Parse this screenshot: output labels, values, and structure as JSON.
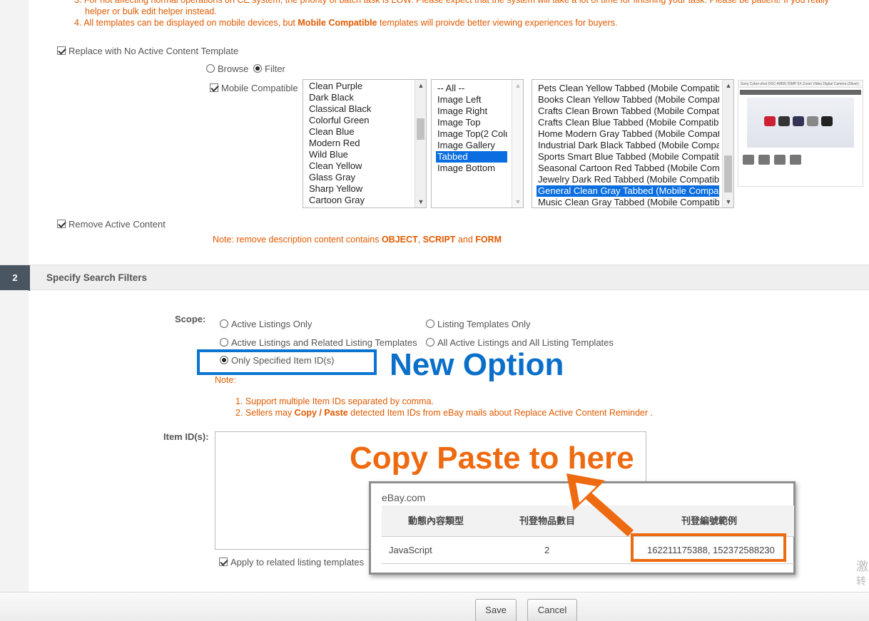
{
  "notes_top": {
    "line3a": "3. For not affecting normal operations on CE system, the priority of batch task is LOW. Please expect that the system will take a lot of time for finishing your task. Please be patient! If you really",
    "line3b": "helper or bulk edit helper instead.",
    "line4_prefix": "4. All templates can be displayed on mobile devices, but ",
    "line4_bold": "Mobile Compatible",
    "line4_suffix": " templates will proivde better viewing experiences for buyers."
  },
  "replace_template": {
    "checkbox_label": "Replace with No Active Content Template",
    "checked": true,
    "radio_browse": "Browse",
    "radio_filter": "Filter",
    "selected_radio": "Filter",
    "mobile_compatible_label": "Mobile Compatible",
    "mobile_compatible_checked": true,
    "styles": [
      "Clean Purple",
      "Dark Black",
      "Classical Black",
      "Colorful Green",
      "Clean Blue",
      "Modern Red",
      "Wild Blue",
      "Clean Yellow",
      "Glass Gray",
      "Sharp Yellow",
      "Cartoon Gray"
    ],
    "layouts": [
      "-- All --",
      "Image Left",
      "Image Right",
      "Image Top",
      "Image Top(2 Colun",
      "Image Gallery",
      "Tabbed",
      "Image Bottom"
    ],
    "layout_selected": "Tabbed",
    "templates": [
      "Pets Clean Yellow Tabbed (Mobile Compatib",
      "Books Clean Yellow Tabbed (Mobile Compat",
      "Crafts Clean Brown Tabbed (Mobile Compatil",
      "Crafts Clean Blue Tabbed (Mobile Compatible",
      "Home Modern Gray Tabbed (Mobile Compati",
      "Industrial Dark Black Tabbed (Mobile Compa",
      "Sports Smart Blue Tabbed (Mobile Compatib",
      "Seasonal Cartoon Red Tabbed (Mobile Comp",
      "Jewelry Dark Red Tabbed (Mobile Compatib",
      "General Clean Gray Tabbed (Mobile Compa",
      "Music Clean Gray Tabbed (Mobile Compatibl"
    ],
    "template_selected": "General Clean Gray Tabbed (Mobile Compa",
    "preview_title": "Sony Cyber-shot DSC-W800 20MP 5X Zoom Video Digital Camera (Silver)"
  },
  "remove_active": {
    "checkbox_label": "Remove Active Content",
    "checked": true,
    "note_prefix": "Note: remove description content contains ",
    "note_object": "OBJECT",
    "note_sep1": ", ",
    "note_script": "SCRIPT",
    "note_and": " and ",
    "note_form": "FORM"
  },
  "section2": {
    "number": "2",
    "title": "Specify Search Filters",
    "scope_label": "Scope:",
    "options": {
      "active_only": "Active Listings Only",
      "templates_only": "Listing Templates Only",
      "active_related": "Active Listings and Related Listing Templates",
      "all": "All Active Listings and All Listing Templates",
      "specified_ids": "Only Specified Item ID(s)"
    },
    "selected_option": "Only Specified Item ID(s)",
    "note_label": "Note:",
    "note1": "1. Support multiple Item IDs separated by comma.",
    "note2_prefix": "2. Sellers may ",
    "note2_bold": "Copy / Paste",
    "note2_suffix": " detected Item IDs from eBay mails about Replace Active Content Reminder .",
    "item_ids_label": "Item ID(s):",
    "item_ids_value": "",
    "apply_related_label": "Apply to related listing templates",
    "apply_related_checked": true
  },
  "annotations": {
    "new_option": "New Option",
    "copy_paste": "Copy Paste to here"
  },
  "ebay_popup": {
    "title": "eBay.com",
    "headers": [
      "動態內容類型",
      "刊登物品數目",
      "刊登編號範例"
    ],
    "row": [
      "JavaScript",
      "2",
      "162211175388, 152372588230"
    ]
  },
  "buttons": {
    "save": "Save",
    "cancel": "Cancel"
  },
  "watermark": [
    "激",
    "转"
  ],
  "colors": {
    "accent_orange": "#e05a00",
    "annotation_blue": "#0a6fc9",
    "annotation_orange": "#ee6a10",
    "selection_blue": "#0a6ee0"
  }
}
